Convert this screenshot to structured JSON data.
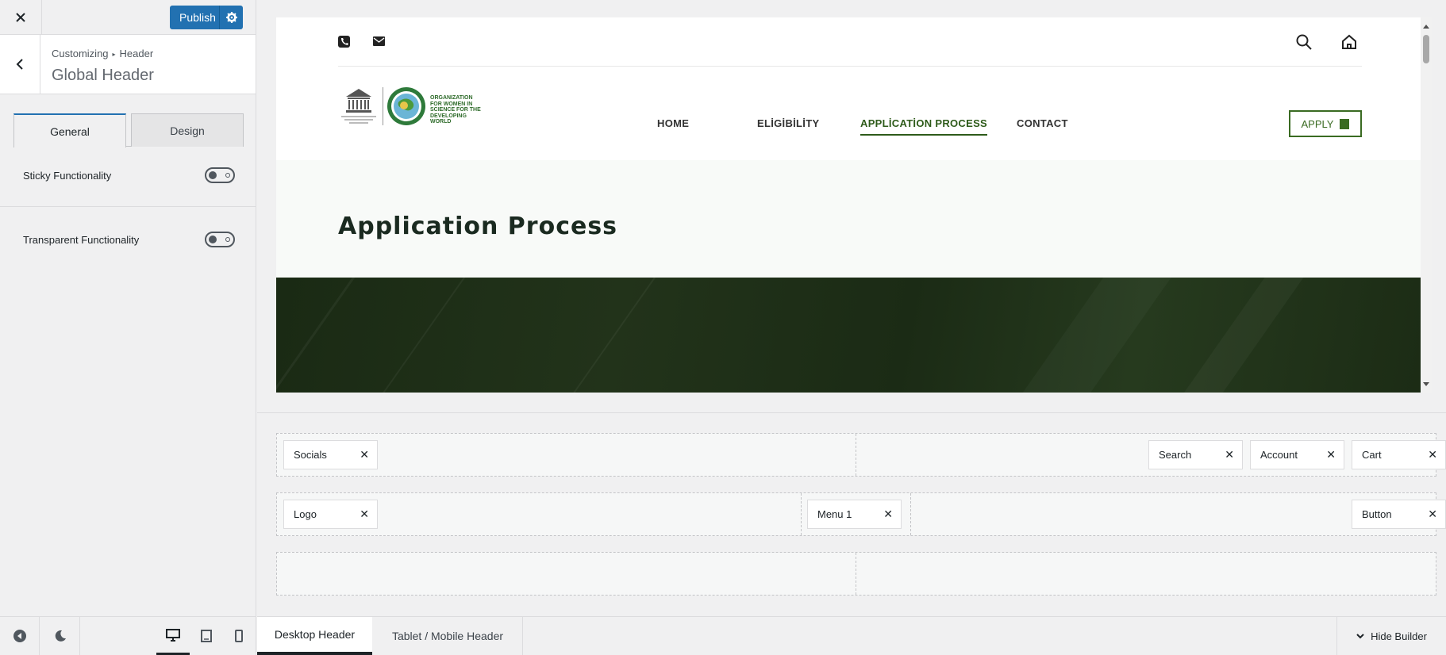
{
  "sidebar": {
    "close_icon": "close-icon",
    "publish_label": "Publish",
    "breadcrumb": {
      "parent": "Customizing",
      "child": "Header"
    },
    "section_title": "Global Header",
    "tabs": [
      {
        "label": "General",
        "active": true
      },
      {
        "label": "Design",
        "active": false
      }
    ],
    "options": [
      {
        "label": "Sticky Functionality",
        "enabled": false
      },
      {
        "label": "Transparent Functionality",
        "enabled": false
      }
    ],
    "footer": {
      "active_device": "desktop"
    }
  },
  "preview": {
    "menu": [
      {
        "label": "HOME",
        "active": false
      },
      {
        "label": "ELİGİBİLİTY",
        "active": false
      },
      {
        "label": "APPLİCATİON PROCESS",
        "active": true
      },
      {
        "label": "CONTACT",
        "active": false
      }
    ],
    "logo_text": [
      "ORGANIZATION",
      "FOR WOMEN IN",
      "SCIENCE FOR THE",
      "DEVELOPING WORLD"
    ],
    "apply_label": "APPLY",
    "page_title": "Application Process",
    "accent_color": "#2e5b1a"
  },
  "builder": {
    "rows": [
      {
        "left": [
          "Socials"
        ],
        "right": [
          "Search",
          "Account",
          "Cart"
        ]
      },
      {
        "left": [
          "Logo"
        ],
        "center": [
          "Menu 1"
        ],
        "right": [
          "Button"
        ]
      },
      {
        "left": [],
        "right": []
      }
    ]
  },
  "bottombar": {
    "tabs": [
      {
        "label": "Desktop Header",
        "active": true
      },
      {
        "label": "Tablet / Mobile Header",
        "active": false
      }
    ],
    "hide_label": "Hide Builder"
  }
}
